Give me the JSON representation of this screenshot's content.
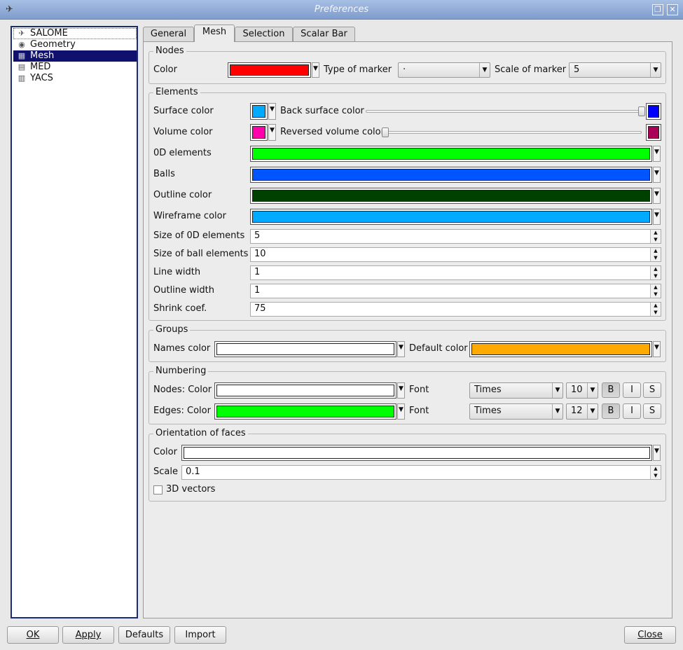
{
  "window": {
    "title": "Preferences",
    "restore_glyph": "❐",
    "close_glyph": "✕"
  },
  "tree": [
    {
      "label": "SALOME",
      "icon": "salome-icon",
      "glyph": "✈"
    },
    {
      "label": "Geometry",
      "icon": "geometry-icon",
      "glyph": "◉"
    },
    {
      "label": "Mesh",
      "icon": "mesh-icon",
      "glyph": "▦"
    },
    {
      "label": "MED",
      "icon": "med-icon",
      "glyph": "▤"
    },
    {
      "label": "YACS",
      "icon": "yacs-icon",
      "glyph": "▥"
    }
  ],
  "tabs": [
    "General",
    "Mesh",
    "Selection",
    "Scalar Bar"
  ],
  "active_tab": "Mesh",
  "nodes": {
    "title": "Nodes",
    "color_label": "Color",
    "color": "#ff0000",
    "marker_label": "Type of marker",
    "marker_value": "·",
    "scale_label": "Scale of marker",
    "scale_value": "5"
  },
  "elements": {
    "title": "Elements",
    "surface_label": "Surface color",
    "surface_color": "#00aaff",
    "back_label": "Back surface color",
    "back_color": "#0000ff",
    "back_slider": 1.0,
    "volume_label": "Volume color",
    "volume_color": "#ff00aa",
    "reversed_label": "Reversed volume color",
    "reversed_color": "#aa0055",
    "reversed_slider": 0.0,
    "el0d_label": "0D elements",
    "el0d_color": "#00ff00",
    "balls_label": "Balls",
    "balls_color": "#0055ff",
    "outline_label": "Outline color",
    "outline_color": "#004000",
    "wire_label": "Wireframe color",
    "wire_color": "#00aaff",
    "size0d_label": "Size of 0D elements",
    "size0d_value": "5",
    "sizeball_label": "Size of ball elements",
    "sizeball_value": "10",
    "linewidth_label": "Line width",
    "linewidth_value": "1",
    "outlinewidth_label": "Outline width",
    "outlinewidth_value": "1",
    "shrink_label": "Shrink coef.",
    "shrink_value": "75"
  },
  "groups": {
    "title": "Groups",
    "names_label": "Names color",
    "names_color": "#ffffff",
    "default_label": "Default color",
    "default_color": "#ffaa00"
  },
  "numbering": {
    "title": "Numbering",
    "nodes_label": "Nodes: Color",
    "nodes_color": "#ffffff",
    "nodes_font_label": "Font",
    "nodes_font": "Times",
    "nodes_size": "10",
    "edges_label": "Edges: Color",
    "edges_color": "#00ff00",
    "edges_font_label": "Font",
    "edges_font": "Times",
    "edges_size": "12",
    "bold": "B",
    "italic": "I",
    "shadow": "S"
  },
  "orientation": {
    "title": "Orientation of faces",
    "color_label": "Color",
    "color": "#ffffff",
    "scale_label": "Scale",
    "scale_value": "0.1",
    "vectors_label": "3D vectors",
    "vectors_checked": false
  },
  "buttons": {
    "ok": "OK",
    "apply": "Apply",
    "defaults": "Defaults",
    "import": "Import",
    "close": "Close"
  }
}
